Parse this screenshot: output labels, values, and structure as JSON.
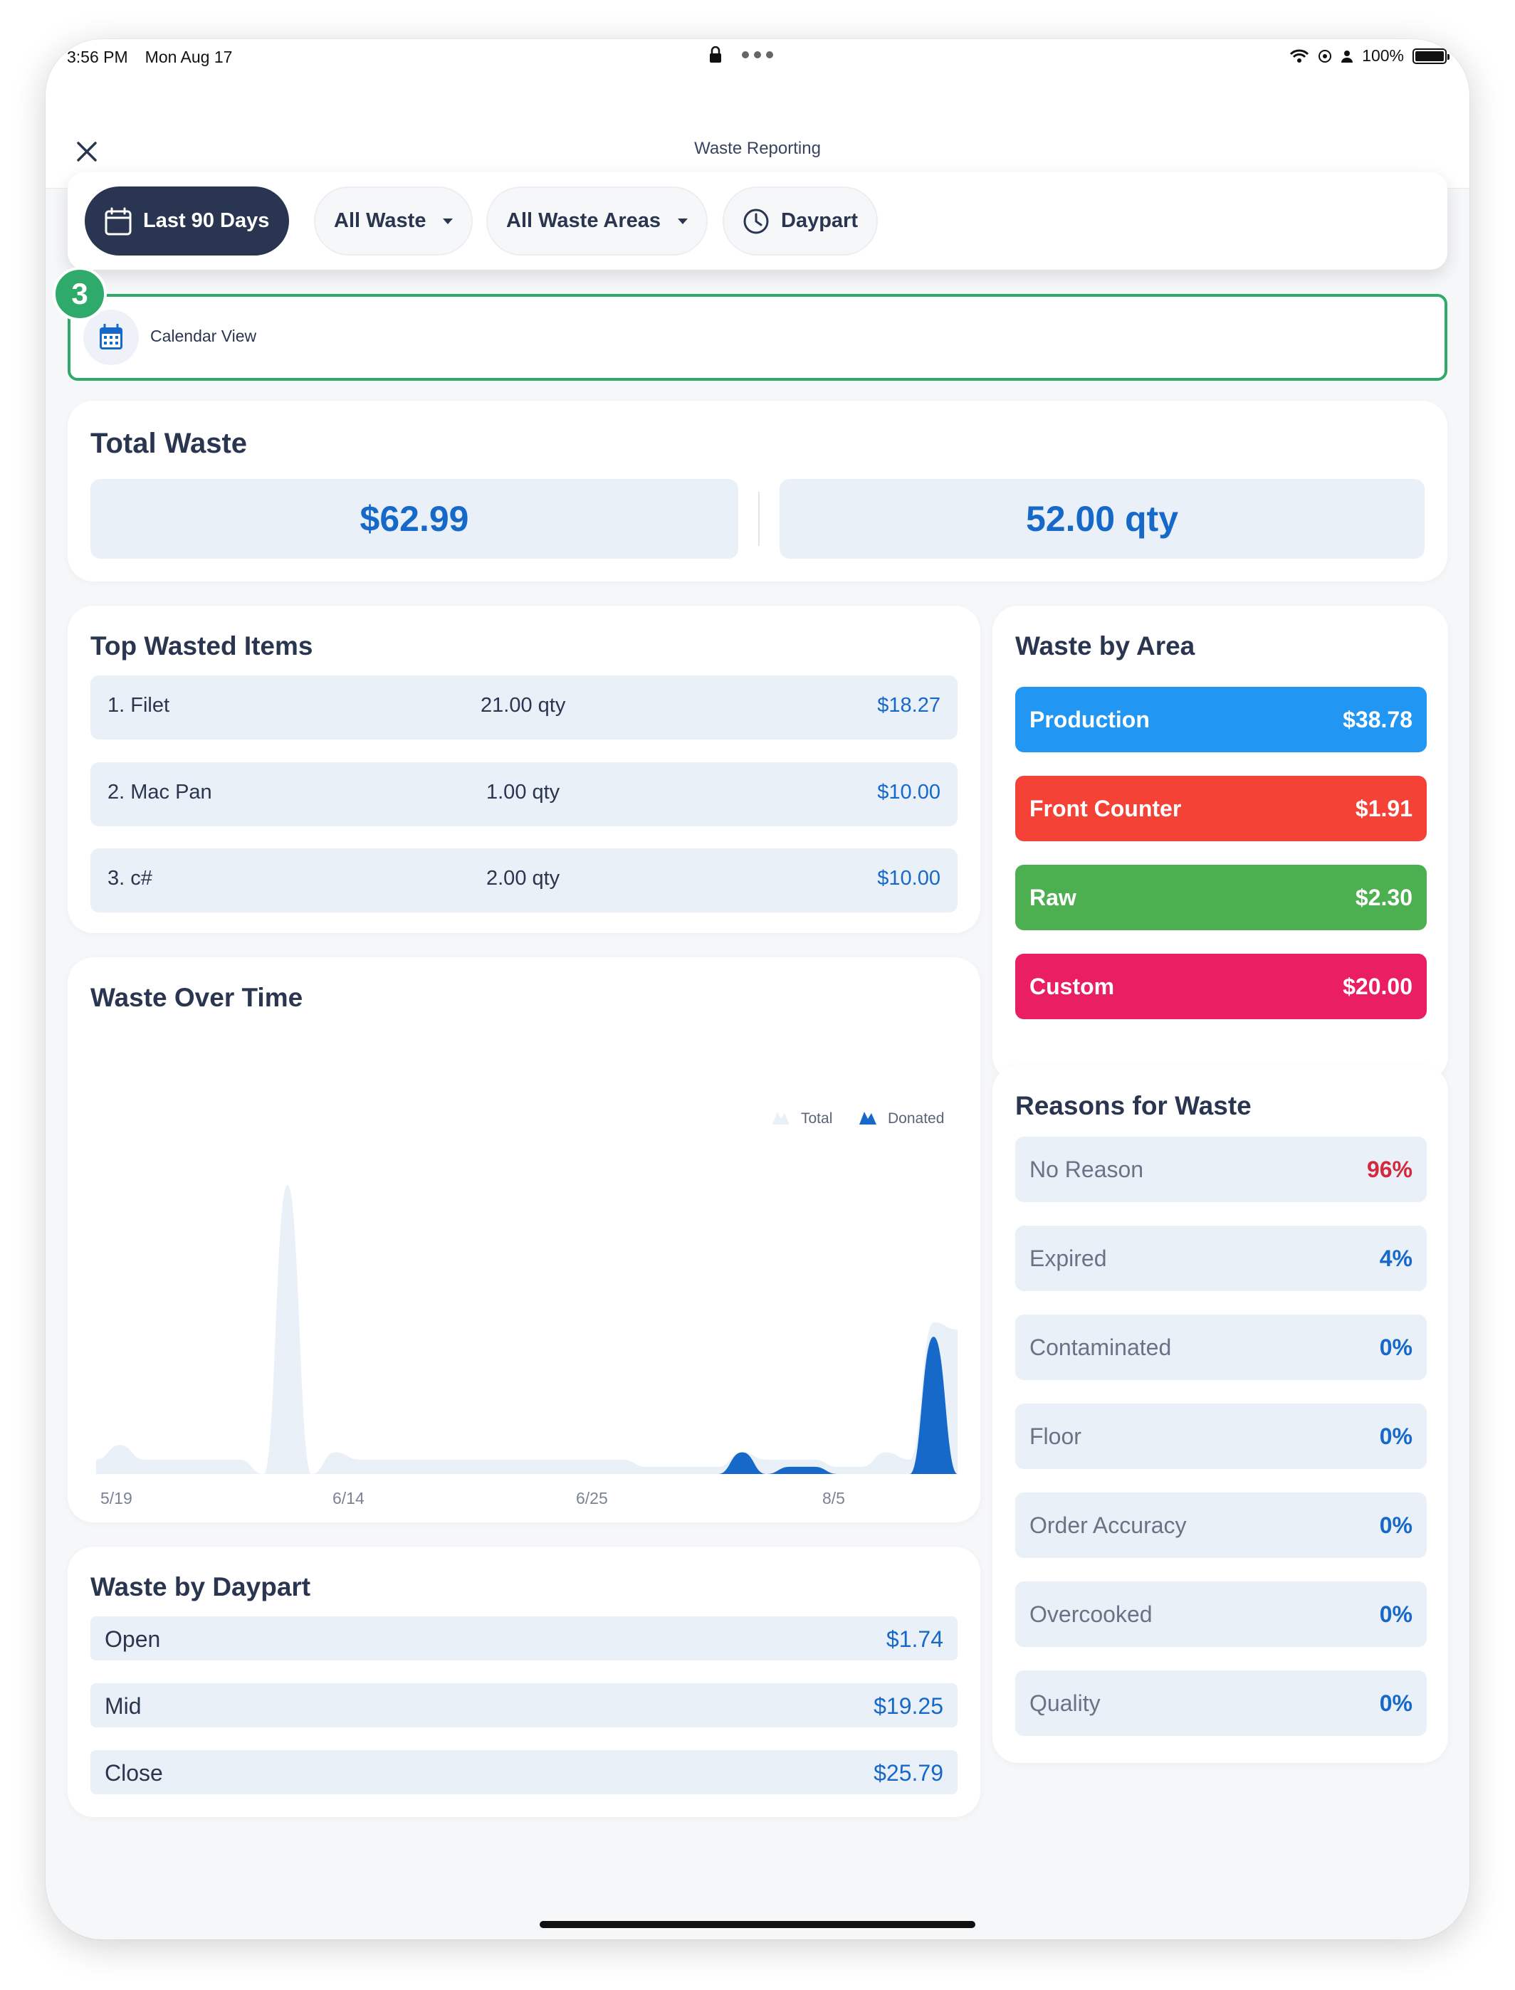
{
  "status_bar": {
    "time": "3:56 PM",
    "date": "Mon Aug 17",
    "battery": "100%"
  },
  "header": {
    "title": "Waste Reporting"
  },
  "filters": [
    {
      "label": "Last 90 Days",
      "active": true
    },
    {
      "label": "All Waste",
      "active": false
    },
    {
      "label": "All Waste Areas",
      "active": false
    },
    {
      "label": "Daypart",
      "active": false
    }
  ],
  "calendar_view": {
    "label": "Calendar View",
    "step_badge": "3"
  },
  "total_waste": {
    "title": "Total Waste",
    "amount": "$62.99",
    "quantity": "52.00 qty"
  },
  "top_wasted": {
    "title": "Top Wasted Items",
    "items": [
      {
        "name": "1. Filet",
        "qty": "21.00 qty",
        "cost": "$18.27"
      },
      {
        "name": "2. Mac Pan",
        "qty": "1.00 qty",
        "cost": "$10.00"
      },
      {
        "name": "3. c#",
        "qty": "2.00 qty",
        "cost": "$10.00"
      }
    ]
  },
  "waste_by_area": {
    "title": "Waste by Area",
    "items": [
      {
        "label": "Production",
        "value": "$38.78",
        "color": "#2196f3"
      },
      {
        "label": "Front Counter",
        "value": "$1.91",
        "color": "#f44336"
      },
      {
        "label": "Raw",
        "value": "$2.30",
        "color": "#4caf50"
      },
      {
        "label": "Custom",
        "value": "$20.00",
        "color": "#e91e63"
      }
    ]
  },
  "waste_over_time": {
    "title": "Waste Over Time",
    "legend": [
      "Total",
      "Donated"
    ],
    "x_labels": [
      "5/19",
      "6/14",
      "6/25",
      "8/5"
    ]
  },
  "chart_data": {
    "type": "area",
    "title": "Waste Over Time",
    "xlabel": "",
    "ylabel": "",
    "x_ticks": [
      "5/19",
      "6/14",
      "6/25",
      "8/5"
    ],
    "series": [
      {
        "name": "Total",
        "color": "#eaf0f8",
        "values": [
          1,
          2,
          1,
          1,
          1,
          1,
          1,
          0,
          20,
          0,
          1.5,
          1,
          1,
          1,
          1,
          1,
          1,
          1,
          1,
          1,
          1,
          1,
          1,
          0.5,
          0.5,
          0.5,
          0.5,
          1.5,
          1,
          1,
          1,
          0.5,
          0.5,
          1.5,
          1,
          10.5,
          10
        ]
      },
      {
        "name": "Donated",
        "color": "#1769c9",
        "values": [
          0,
          0,
          0,
          0,
          0,
          0,
          0,
          0,
          0,
          0,
          0,
          0,
          0,
          0,
          0,
          0,
          0,
          0,
          0,
          0,
          0,
          0,
          0,
          0,
          0,
          0,
          0,
          1.5,
          0,
          0.5,
          0.5,
          0,
          0,
          0,
          0,
          9.5,
          0
        ]
      }
    ],
    "grid": false,
    "legend_position": "top-right"
  },
  "waste_by_daypart": {
    "title": "Waste by Daypart",
    "items": [
      {
        "label": "Open",
        "value": "$1.74"
      },
      {
        "label": "Mid",
        "value": "$19.25"
      },
      {
        "label": "Close",
        "value": "$25.79"
      }
    ]
  },
  "reasons": {
    "title": "Reasons for Waste",
    "items": [
      {
        "label": "No Reason",
        "value": "96%",
        "highlight": true
      },
      {
        "label": "Expired",
        "value": "4%",
        "highlight": false
      },
      {
        "label": "Contaminated",
        "value": "0%",
        "highlight": false
      },
      {
        "label": "Floor",
        "value": "0%",
        "highlight": false
      },
      {
        "label": "Order Accuracy",
        "value": "0%",
        "highlight": false
      },
      {
        "label": "Overcooked",
        "value": "0%",
        "highlight": false
      },
      {
        "label": "Quality",
        "value": "0%",
        "highlight": false
      }
    ]
  },
  "icons": [
    "close-icon",
    "calendar-icon",
    "caret-down-icon",
    "clock-icon",
    "lock-icon",
    "wifi-icon",
    "battery-icon"
  ]
}
